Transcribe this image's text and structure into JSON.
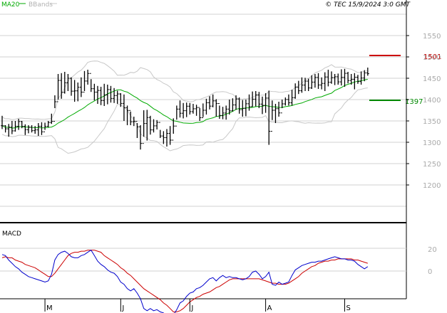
{
  "header": {
    "legend_ma": "MA20",
    "legend_bb": "BBands",
    "copyright": "© TEC 15/9/2024 3:0 GMT"
  },
  "colors": {
    "price": "#000000",
    "ma": "#00aa00",
    "bands": "#c8c8c8",
    "grid": "#d0d0d0",
    "resistance": "#cc0000",
    "support": "#008800",
    "macd": "#0000cc",
    "signal": "#cc0000",
    "axis_text": "#aaaaaa"
  },
  "chart_data": [
    {
      "type": "ohlc",
      "ylim": [
        1150,
        1600
      ],
      "yticks": [
        "1550",
        "1500",
        "1450",
        "1400",
        "1350",
        "1300",
        "1250",
        "1200"
      ],
      "grid": true,
      "x_labels": [
        {
          "label": "M",
          "index": 13
        },
        {
          "label": "J",
          "index": 36
        },
        {
          "label": "J",
          "index": 57
        },
        {
          "label": "A",
          "index": 80
        },
        {
          "label": "S",
          "index": 104
        }
      ],
      "levels": {
        "resistance": {
          "label": "1501",
          "value": 1501
        },
        "support": {
          "label": "1397",
          "value": 1397
        }
      },
      "series": [
        {
          "name": "price",
          "style": "ohlc",
          "highs": [
            1362,
            1340,
            1343,
            1350,
            1350,
            1355,
            1350,
            1342,
            1340,
            1340,
            1338,
            1345,
            1347,
            1346,
            1350,
            1367,
            1410,
            1460,
            1462,
            1465,
            1460,
            1452,
            1446,
            1440,
            1452,
            1467,
            1470,
            1448,
            1437,
            1432,
            1430,
            1437,
            1435,
            1432,
            1427,
            1421,
            1415,
            1412,
            1386,
            1372,
            1360,
            1345,
            1340,
            1375,
            1376,
            1362,
            1354,
            1352,
            1329,
            1326,
            1331,
            1338,
            1356,
            1386,
            1398,
            1392,
            1393,
            1392,
            1390,
            1388,
            1380,
            1391,
            1402,
            1408,
            1412,
            1401,
            1386,
            1383,
            1386,
            1400,
            1403,
            1410,
            1405,
            1399,
            1400,
            1412,
            1419,
            1420,
            1418,
            1407,
            1415,
            1421,
            1398,
            1390,
            1395,
            1400,
            1405,
            1412,
            1423,
            1438,
            1444,
            1452,
            1451,
            1449,
            1457,
            1460,
            1462,
            1452,
            1464,
            1470,
            1466,
            1460,
            1461,
            1471,
            1472,
            1465,
            1460,
            1462,
            1458,
            1466,
            1469,
            1475
          ],
          "lows": [
            1331,
            1323,
            1313,
            1319,
            1325,
            1329,
            1333,
            1317,
            1321,
            1323,
            1320,
            1315,
            1317,
            1329,
            1335,
            1343,
            1380,
            1400,
            1402,
            1414,
            1420,
            1409,
            1395,
            1396,
            1406,
            1420,
            1435,
            1418,
            1398,
            1390,
            1387,
            1385,
            1389,
            1393,
            1392,
            1390,
            1383,
            1350,
            1340,
            1340,
            1338,
            1310,
            1283,
            1313,
            1304,
            1318,
            1323,
            1330,
            1310,
            1296,
            1290,
            1294,
            1320,
            1353,
            1358,
            1356,
            1359,
            1365,
            1367,
            1362,
            1350,
            1359,
            1365,
            1377,
            1382,
            1360,
            1355,
            1354,
            1353,
            1365,
            1372,
            1376,
            1367,
            1360,
            1361,
            1374,
            1383,
            1384,
            1380,
            1366,
            1369,
            1294,
            1352,
            1345,
            1360,
            1380,
            1386,
            1386,
            1386,
            1402,
            1413,
            1416,
            1420,
            1420,
            1425,
            1428,
            1425,
            1424,
            1420,
            1431,
            1437,
            1434,
            1435,
            1433,
            1430,
            1438,
            1435,
            1424,
            1437,
            1435,
            1443,
            1456
          ]
        }
      ]
    },
    {
      "type": "line",
      "title": "MACD",
      "ylim": [
        -45,
        40
      ],
      "yticks": [
        "20",
        "0"
      ],
      "series": [
        {
          "name": "macd",
          "values": [
            15,
            14,
            10,
            7,
            4,
            2,
            -1,
            -3,
            -5,
            -6,
            -7,
            -8,
            -9,
            -10,
            -9,
            -3,
            10,
            15,
            17,
            18,
            16,
            13,
            12,
            12,
            14,
            15,
            17,
            19,
            14,
            9,
            6,
            4,
            1,
            -1,
            -2,
            -5,
            -10,
            -12,
            -16,
            -18,
            -16,
            -20,
            -25,
            -34,
            -36,
            -34,
            -36,
            -35,
            -37,
            -38,
            -41,
            -43,
            -40,
            -35,
            -29,
            -27,
            -23,
            -20,
            -19,
            -16,
            -15,
            -13,
            -10,
            -7,
            -6,
            -9,
            -6,
            -4,
            -6,
            -5,
            -6,
            -6,
            -7,
            -8,
            -7,
            -5,
            -1,
            0,
            -3,
            -7,
            -5,
            -1,
            -12,
            -13,
            -10,
            -12,
            -11,
            -10,
            -4,
            1,
            3,
            5,
            6,
            7,
            8,
            8,
            9,
            9,
            10,
            11,
            12,
            13,
            12,
            11,
            11,
            10,
            10,
            9,
            6,
            4,
            2,
            4
          ]
        },
        {
          "name": "signal",
          "values": [
            12,
            13,
            12,
            12,
            10,
            9,
            8,
            6,
            5,
            4,
            3,
            1,
            -1,
            -3,
            -5,
            -5,
            -2,
            2,
            6,
            10,
            14,
            16,
            17,
            17,
            18,
            18,
            19,
            19,
            19,
            18,
            17,
            14,
            12,
            10,
            8,
            6,
            3,
            1,
            -2,
            -4,
            -7,
            -10,
            -13,
            -16,
            -18,
            -20,
            -22,
            -24,
            -26,
            -29,
            -31,
            -34,
            -37,
            -37,
            -36,
            -34,
            -31,
            -28,
            -26,
            -24,
            -23,
            -21,
            -20,
            -19,
            -17,
            -15,
            -14,
            -12,
            -10,
            -8,
            -7,
            -7,
            -7,
            -7,
            -7,
            -7,
            -7,
            -7,
            -7,
            -8,
            -9,
            -10,
            -11,
            -11,
            -12,
            -12,
            -12,
            -11,
            -9,
            -7,
            -5,
            -2,
            0,
            2,
            4,
            5,
            7,
            8,
            9,
            9,
            10,
            10,
            11,
            11,
            11,
            11,
            11,
            10,
            10,
            9,
            8,
            7
          ]
        }
      ]
    }
  ]
}
